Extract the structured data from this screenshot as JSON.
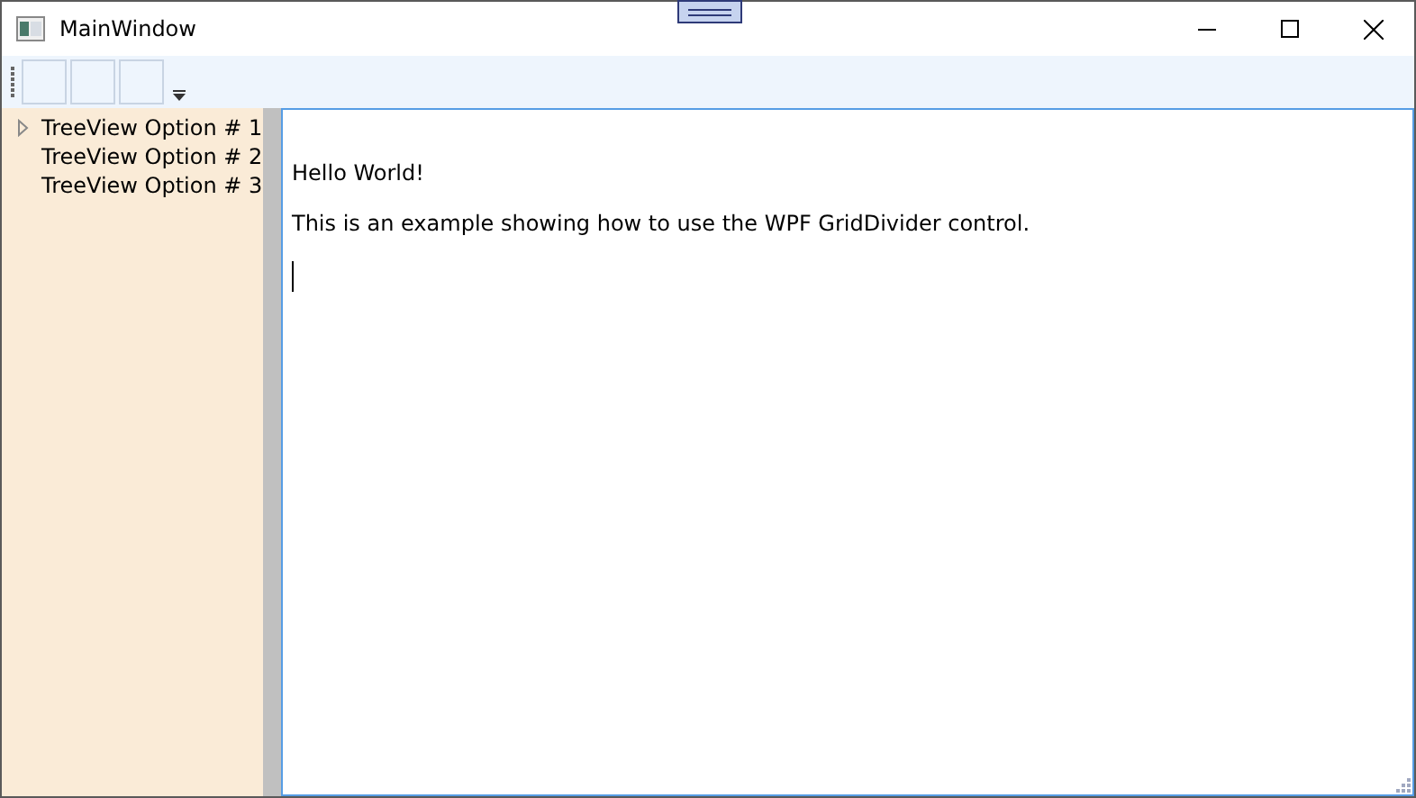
{
  "window": {
    "title": "MainWindow"
  },
  "toolbar": {
    "buttons": [
      {
        "kind": "blank"
      },
      {
        "kind": "blank"
      },
      {
        "kind": "blank"
      }
    ]
  },
  "tree": {
    "items": [
      {
        "label": "TreeView Option # 1",
        "kind": "branch",
        "expanded": false
      },
      {
        "label": "TreeView Option # 2",
        "kind": "leaf"
      },
      {
        "label": "TreeView Option # 3",
        "kind": "leaf"
      }
    ]
  },
  "editor": {
    "paragraphs": [
      "Hello World!",
      "This is an example showing how to use the WPF GridDivider control."
    ]
  }
}
